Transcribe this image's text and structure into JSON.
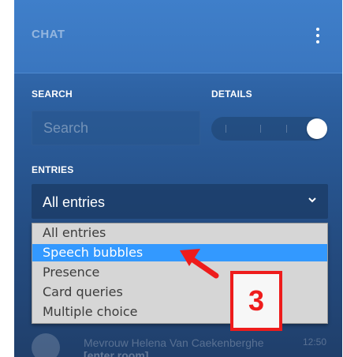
{
  "header": {
    "title": "CHAT",
    "menu_icon": "kebab-menu-icon"
  },
  "search": {
    "label": "SEARCH",
    "placeholder": "Search",
    "value": ""
  },
  "details": {
    "label": "DETAILS",
    "toggle_on": true
  },
  "entries": {
    "label": "ENTRIES",
    "selected_value": "All entries",
    "options": [
      "All entries",
      "Speech bubbles",
      "Presence",
      "Card queries",
      "Multiple choice"
    ],
    "highlighted_index": 1
  },
  "message": {
    "author": "Mevrouw Helena Van Caekenberghe",
    "time": "12:50",
    "text": "[enter room]"
  },
  "annotation": {
    "number": "3",
    "color": "#ee1c1c"
  },
  "colors": {
    "panel": "#2c5f9f",
    "highlight": "#3399ff",
    "annotation": "#ee1c1c"
  }
}
